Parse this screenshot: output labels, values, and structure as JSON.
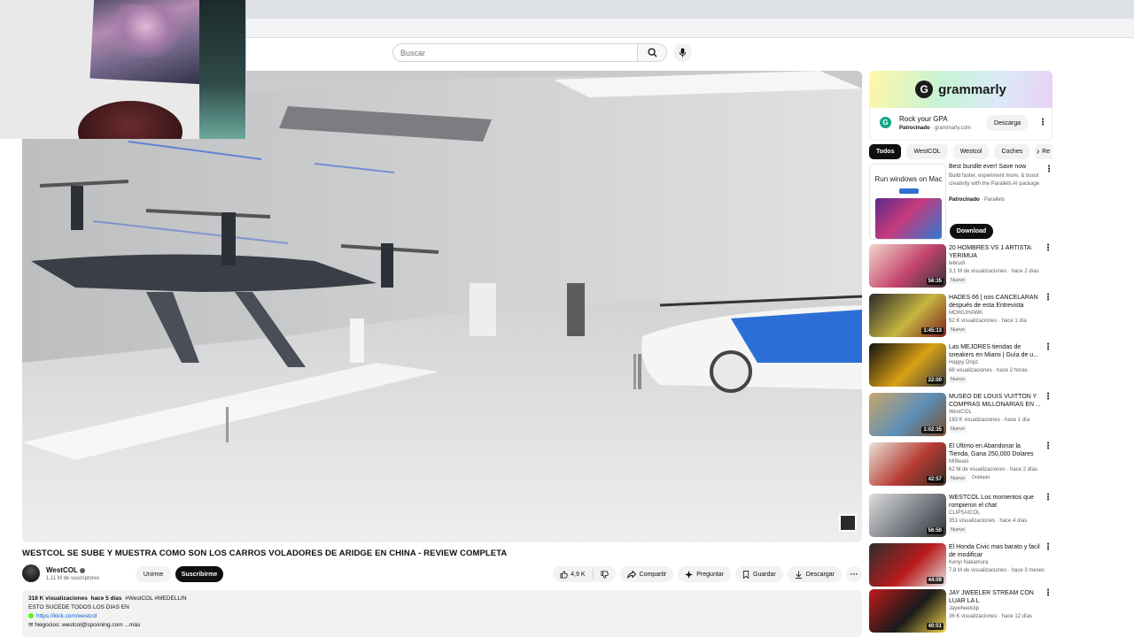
{
  "search": {
    "placeholder": "Buscar"
  },
  "video": {
    "title": "WESTCOL SE SUBE Y MUESTRA COMO SON LOS CARROS VOLADORES DE ARIDGE EN CHINA - REVIEW COMPLETA",
    "channel": "WestCOL",
    "subscribers": "1,11 M de suscriptores",
    "join_label": "Unirme",
    "subscribe_label": "Suscribirme",
    "likes": "4,9 K",
    "share_label": "Compartir",
    "ask_label": "Preguntar",
    "save_label": "Guardar",
    "download_label": "Descargar",
    "description": {
      "views": "318 K visualizaciones",
      "date": "hace 5 días",
      "tags": "#WestCOL #MEDELLIN",
      "line1": "ESTO SUCEDE TODOS LOS DIAS EN",
      "link": "https://kick.com/westcol",
      "line3": "✉ Negocios: westcol@spooning.com",
      "more": "...más"
    }
  },
  "ad": {
    "brand": "grammarly",
    "headline": "Rock your GPA",
    "sponsored": "Patrocinado",
    "domain": "grammarly.com",
    "cta": "Descarga"
  },
  "chips": [
    "Todos",
    "WestCOL",
    "Westcol",
    "Coches",
    "Re"
  ],
  "promo": {
    "thumb_text": "Run windows on Mac",
    "title": "Best bundle ever! Save now",
    "desc": "Build faster, experiment more, & boost creativity with the Parallels AI package",
    "sponsored": "Patrocinado",
    "advertiser": "Parallels",
    "cta": "Download"
  },
  "recommendations": [
    {
      "title": "20 HOMBRES VS 1 ARTISTA: YERIMUA",
      "channel": "lebrudi",
      "stats": "3,1 M de visualizaciones · hace 2 días",
      "badge": "Nuevo",
      "badge2": "",
      "duration": "56:35",
      "colors": [
        "#f2d6c9",
        "#c3456e",
        "#38303a"
      ]
    },
    {
      "title": "HADES 66 | nos CANCELARAN después de esta Entrevista",
      "channel": "MOWLIHAWK",
      "stats": "52 K visualizaciones · hace 1 día",
      "badge": "Nuevo",
      "badge2": "",
      "duration": "1:45:13",
      "colors": [
        "#2a2a2a",
        "#c7b540",
        "#7b2222"
      ]
    },
    {
      "title": "Las MEJORES tiendas de sneakers en Miami | Guía de u...",
      "channel": "Happy Dripz",
      "stats": "68 visualizaciones · hace 2 horas",
      "badge": "Nuevo",
      "badge2": "",
      "duration": "22:00",
      "colors": [
        "#111111",
        "#d9a114",
        "#3d3d3d"
      ]
    },
    {
      "title": "MUSEO DE LOUIS VUITTON Y COMPRAS MILLONARIAS EN ...",
      "channel": "WestCOL",
      "stats": "183 K visualizaciones · hace 1 día",
      "badge": "Nuevo",
      "badge2": "",
      "duration": "1:02:35",
      "colors": [
        "#c9a56b",
        "#5d8fb8",
        "#7a4d2b"
      ]
    },
    {
      "title": "El Último en Abandonar la Tienda, Gana 250,000 Dolares",
      "channel": "MrBeast",
      "stats": "62 M de visualizaciones · hace 2 días",
      "badge": "Nuevo",
      "badge2": "Doblado",
      "duration": "42:57",
      "colors": [
        "#e8e3d8",
        "#b73c34",
        "#3a2c22"
      ]
    },
    {
      "title": "WESTCOL Los momentos que rompieron el chat",
      "channel": "CLIPSAICOL",
      "stats": "351 visualizaciones · hace 4 días",
      "badge": "Nuevo",
      "badge2": "",
      "duration": "56:50",
      "colors": [
        "#dcdcdc",
        "#7a7f86",
        "#2f3338"
      ]
    },
    {
      "title": "El Honda Civic mas barato y facil de modificar",
      "channel": "Kenyi Nakamura",
      "stats": "7,8 M de visualizaciones · hace 3 meses",
      "badge": "",
      "badge2": "",
      "duration": "44:09",
      "colors": [
        "#2e2e2e",
        "#b91c1c",
        "#e4e4e4"
      ]
    },
    {
      "title": "JAY JWEELER STREAM CON LUAR LA L",
      "channel": "Jaywheelclip",
      "stats": "36 K visualizaciones · hace 12 días",
      "badge": "",
      "badge2": "",
      "duration": "40:51",
      "colors": [
        "#c01b1b",
        "#1a1a1a",
        "#f1d34a"
      ]
    }
  ]
}
